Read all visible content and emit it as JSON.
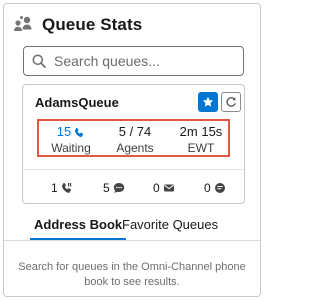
{
  "header": {
    "title": "Queue Stats",
    "icon": "queue-people-icon"
  },
  "search": {
    "placeholder": "Search queues...",
    "value": ""
  },
  "queue_card": {
    "name": "AdamsQueue",
    "favorite_icon": "star-icon",
    "refresh_icon": "refresh-icon",
    "highlight_color": "#e0583f",
    "stats": {
      "waiting": {
        "value": "15",
        "label": "Waiting",
        "icon": "phone-icon"
      },
      "agents": {
        "value": "5 / 74",
        "label": "Agents"
      },
      "ewt": {
        "value": "2m 15s",
        "label": "EWT"
      }
    },
    "channel_counts": [
      {
        "value": "1",
        "icon": "phone-icon"
      },
      {
        "value": "5",
        "icon": "chat-icon"
      },
      {
        "value": "0",
        "icon": "email-icon"
      },
      {
        "value": "0",
        "icon": "messaging-icon"
      }
    ]
  },
  "tabs": [
    {
      "label": "Address Book",
      "active": true
    },
    {
      "label": "Favorite Queues",
      "active": false
    }
  ],
  "empty_message": "Search for queues in the Omni-Channel phone book to see results.",
  "colors": {
    "brand": "#0176d3",
    "border": "#c9c9c9",
    "muted_text": "#706e6b"
  }
}
